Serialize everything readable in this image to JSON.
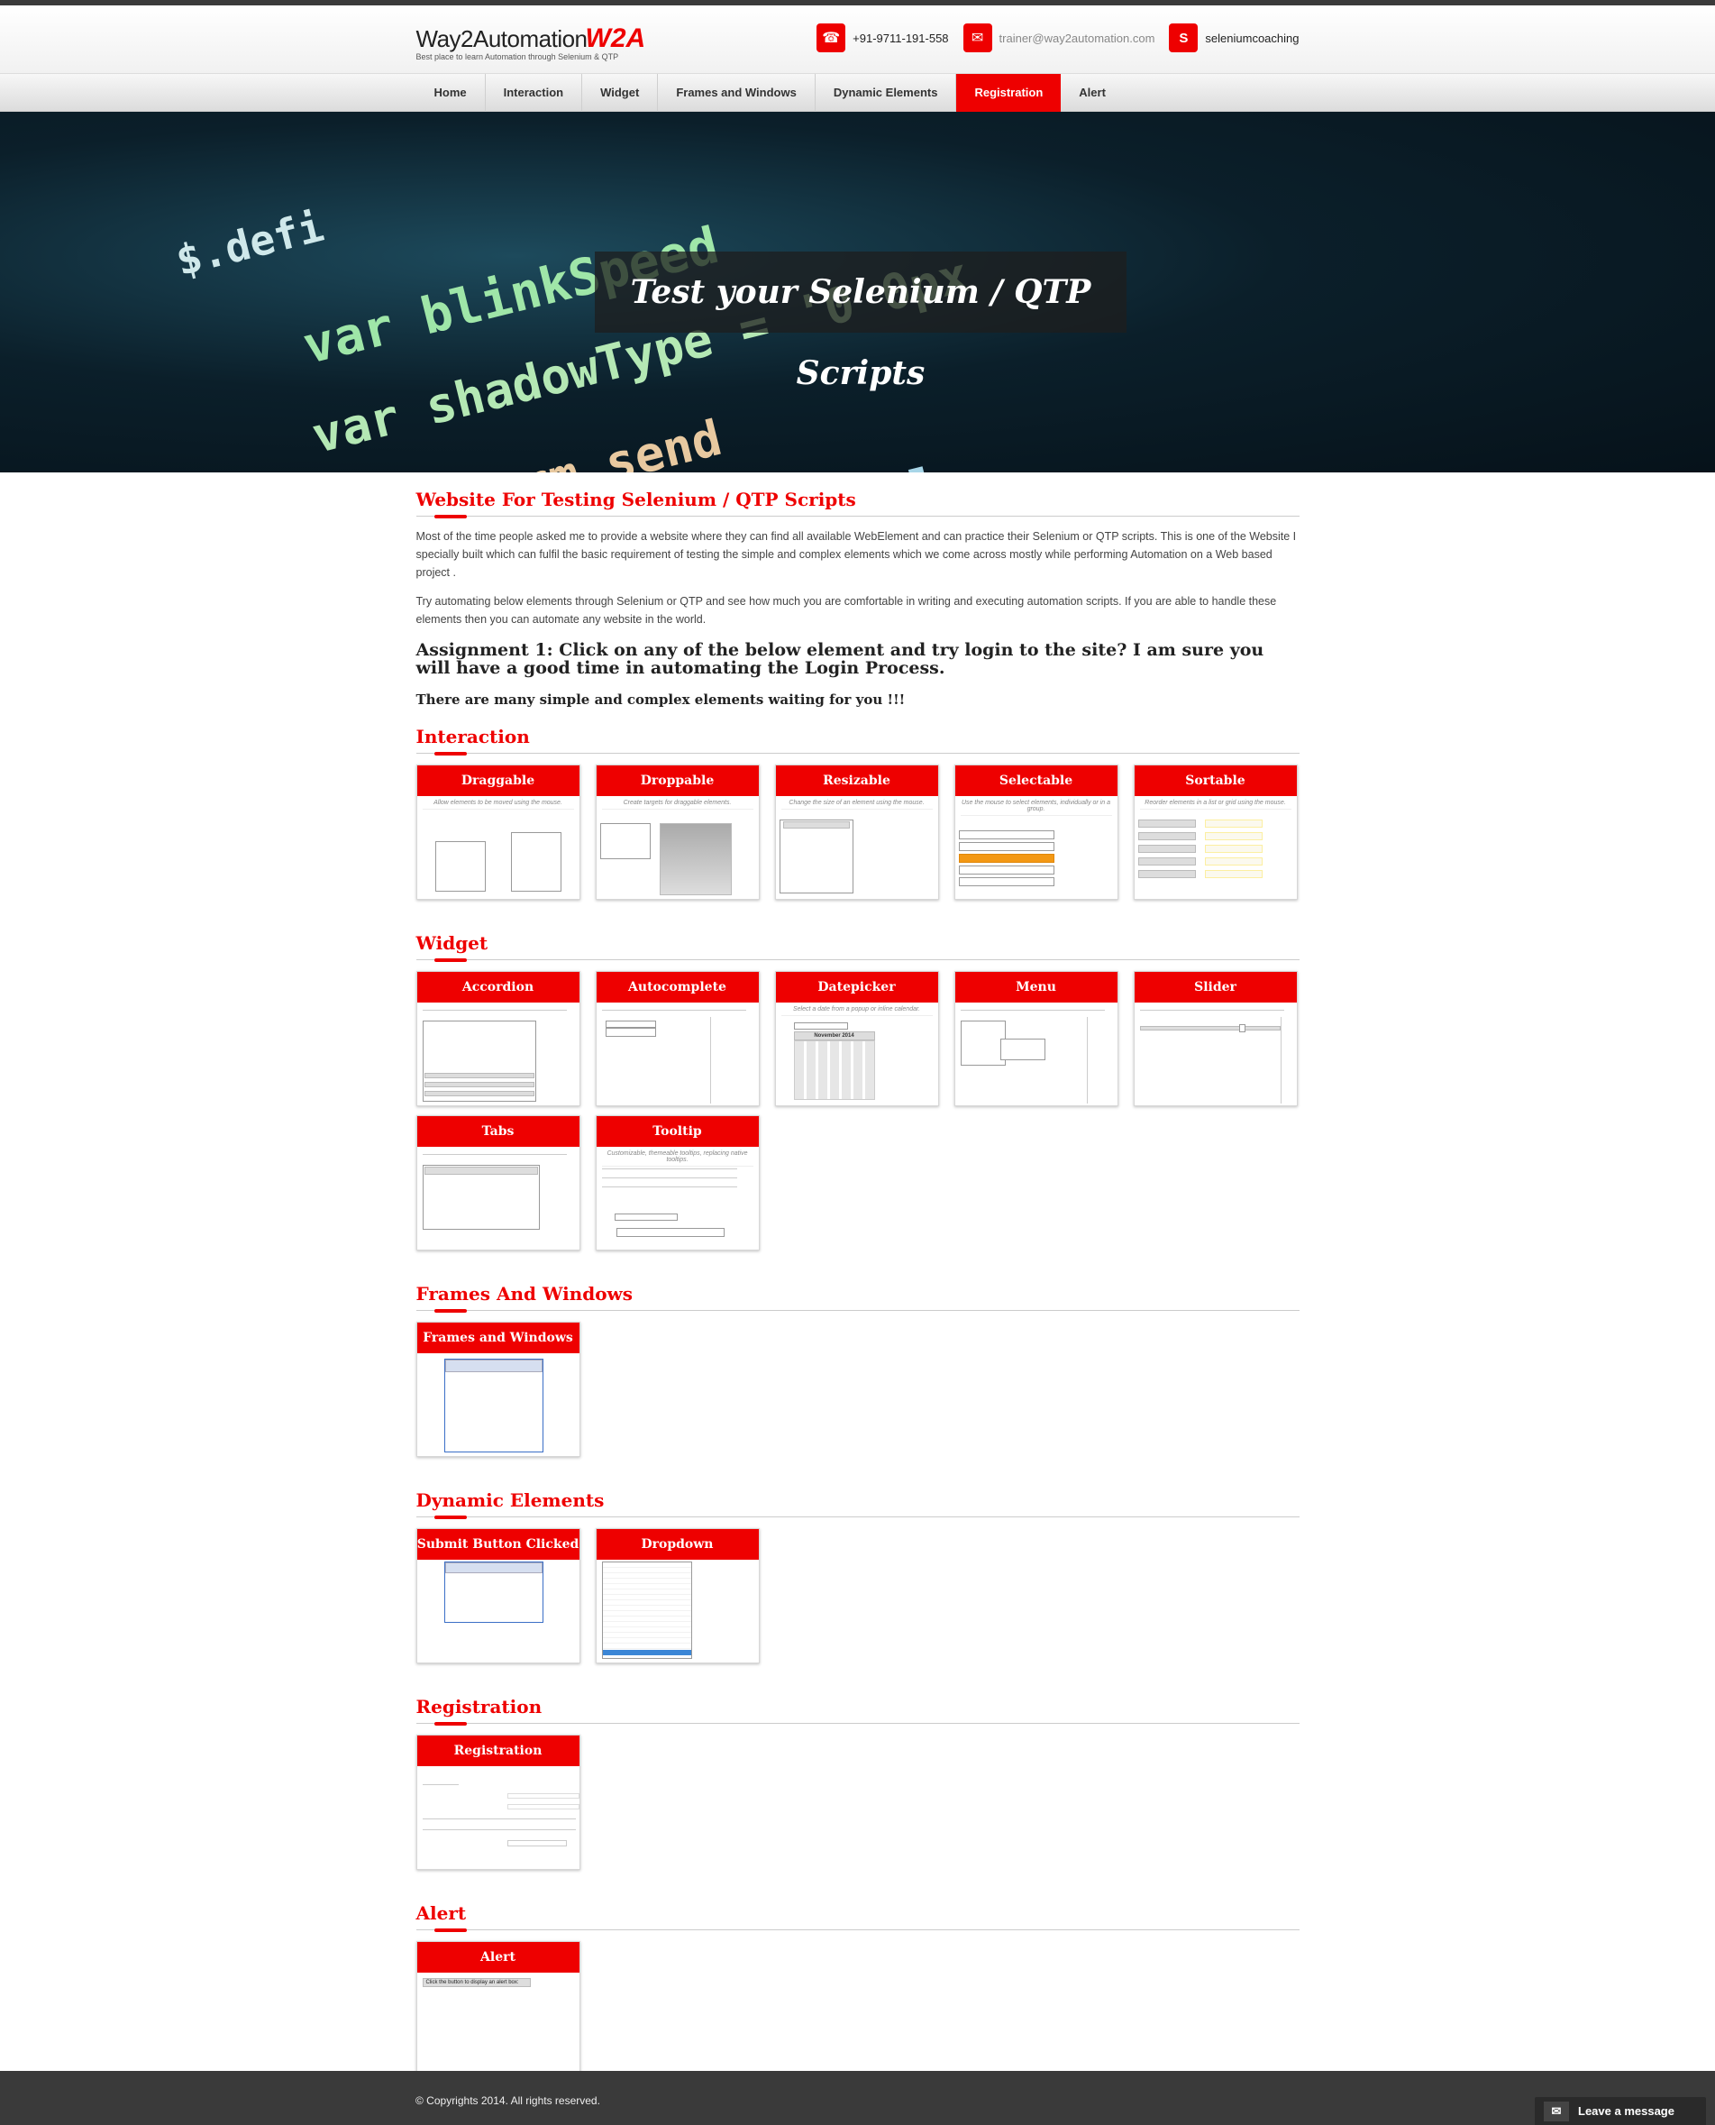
{
  "header": {
    "logo_text": "Way2Automation",
    "logo_mark": "W2A",
    "tagline": "Best place to learn Automation through Selenium & QTP",
    "phone": "+91-9711-191-558",
    "email": "trainer@way2automation.com",
    "skype": "seleniumcoaching",
    "icons": {
      "phone": "phone-icon",
      "email": "envelope-icon",
      "skype": "skype-icon"
    }
  },
  "nav": {
    "items": [
      "Home",
      "Interaction",
      "Widget",
      "Frames and Windows",
      "Dynamic Elements",
      "Registration",
      "Alert"
    ],
    "active": "Registration"
  },
  "hero": {
    "title": "Test your Selenium / QTP Scripts",
    "code_lines": [
      "$.defi",
      "var blinkSpeed",
      "var shadowType = '0 0px",
      "$('a#form_send",
      "doTimeout('scroll"
    ]
  },
  "intro": {
    "heading": "Website For Testing Selenium / QTP Scripts",
    "para1": "Most of the time people asked me to provide a website where they can find all available WebElement and can practice their Selenium or QTP scripts. This is one of the Website I specially built which can fulfil the basic requirement of testing the simple and complex elements which we come across mostly while performing Automation on a Web based project .",
    "para2": "Try automating below elements through Selenium or QTP and see how much you are comfortable in writing and executing automation scripts. If you are able to handle these elements then you can automate any website in the world.",
    "assignment": "Assignment 1: Click on any of the below element and try login to the site? I am sure you will have a good time in automating the Login Process.",
    "subtitle": "There are many simple and complex elements waiting for you !!!"
  },
  "sections": {
    "interaction": {
      "title": "Interaction",
      "cards": [
        {
          "label": "Draggable",
          "desc": "Allow elements to be moved using the mouse."
        },
        {
          "label": "Droppable",
          "desc": "Create targets for draggable elements."
        },
        {
          "label": "Resizable",
          "desc": "Change the size of an element using the mouse."
        },
        {
          "label": "Selectable",
          "desc": "Use the mouse to select elements, individually or in a group."
        },
        {
          "label": "Sortable",
          "desc": "Reorder elements in a list or grid using the mouse."
        }
      ]
    },
    "widget": {
      "title": "Widget",
      "cards": [
        {
          "label": "Accordion"
        },
        {
          "label": "Autocomplete"
        },
        {
          "label": "Datepicker",
          "desc": "Select a date from a popup or inline calendar.",
          "month": "November 2014"
        },
        {
          "label": "Menu"
        },
        {
          "label": "Slider"
        },
        {
          "label": "Tabs"
        },
        {
          "label": "Tooltip",
          "desc": "Customizable, themeable tooltips, replacing native tooltips."
        }
      ]
    },
    "frames": {
      "title": "Frames And Windows",
      "cards": [
        {
          "label": "Frames and Windows"
        }
      ]
    },
    "dynamic": {
      "title": "Dynamic Elements",
      "cards": [
        {
          "label": "Submit Button Clicked"
        },
        {
          "label": "Dropdown"
        }
      ]
    },
    "registration": {
      "title": "Registration",
      "cards": [
        {
          "label": "Registration"
        }
      ]
    },
    "alert": {
      "title": "Alert",
      "cards": [
        {
          "label": "Alert",
          "button": "Click the button to display an alert box:"
        }
      ]
    }
  },
  "footer": {
    "copyright": "© Copyrights 2014. All rights reserved.",
    "chat_label": "Leave a message",
    "chat_icon": "envelope-icon"
  },
  "colors": {
    "brand_red": "#ee0000",
    "dark": "#3a3a3a"
  }
}
